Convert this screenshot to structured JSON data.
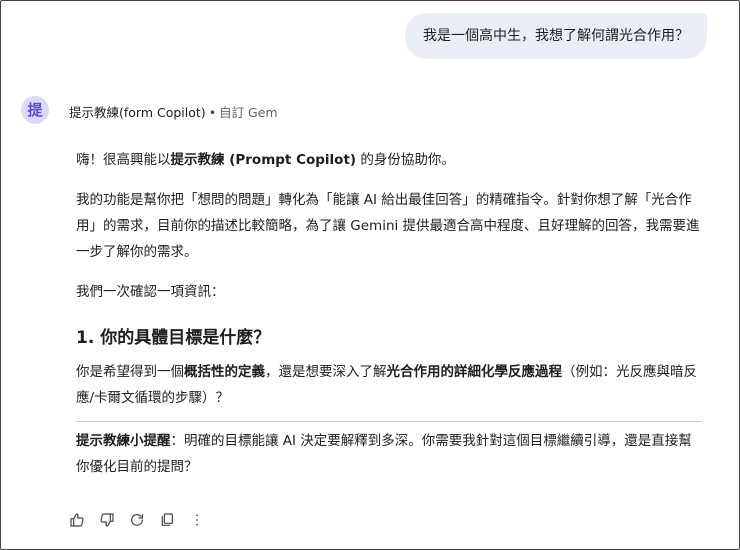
{
  "user_message": "我是一個高中生，我想了解何謂光合作用？",
  "gem": {
    "avatar_char": "提",
    "name": "提示教練(form Copilot)",
    "separator": "•",
    "type": "自訂 Gem"
  },
  "response": {
    "p1_a": "嗨！很高興能以",
    "p1_b": "提示教練 (Prompt Copilot)",
    "p1_c": " 的身份協助你。",
    "p2": "我的功能是幫你把「想問的問題」轉化為「能讓 AI 給出最佳回答」的精確指令。針對你想了解「光合作用」的需求，目前你的描述比較簡略，為了讓 Gemini 提供最適合高中程度、且好理解的回答，我需要進一步了解你的需求。",
    "p3": "我們一次確認一項資訊：",
    "heading": "1. 你的具體目標是什麼？",
    "q_a": "你是希望得到一個",
    "q_b": "概括性的定義",
    "q_c": "，還是想要深入了解",
    "q_d": "光合作用的詳細化學反應過程",
    "q_e": "（例如：光反應與暗反應/卡爾文循環的步驟）？",
    "tip_label": "提示教練小提醒",
    "tip_text": "：明確的目標能讓 AI 決定要解釋到多深。你需要我針對這個目標繼續引導，還是直接幫你優化目前的提問？"
  },
  "actions": [
    "thumbs-up-icon",
    "thumbs-down-icon",
    "regenerate-icon",
    "copy-icon",
    "more-vert-icon"
  ]
}
